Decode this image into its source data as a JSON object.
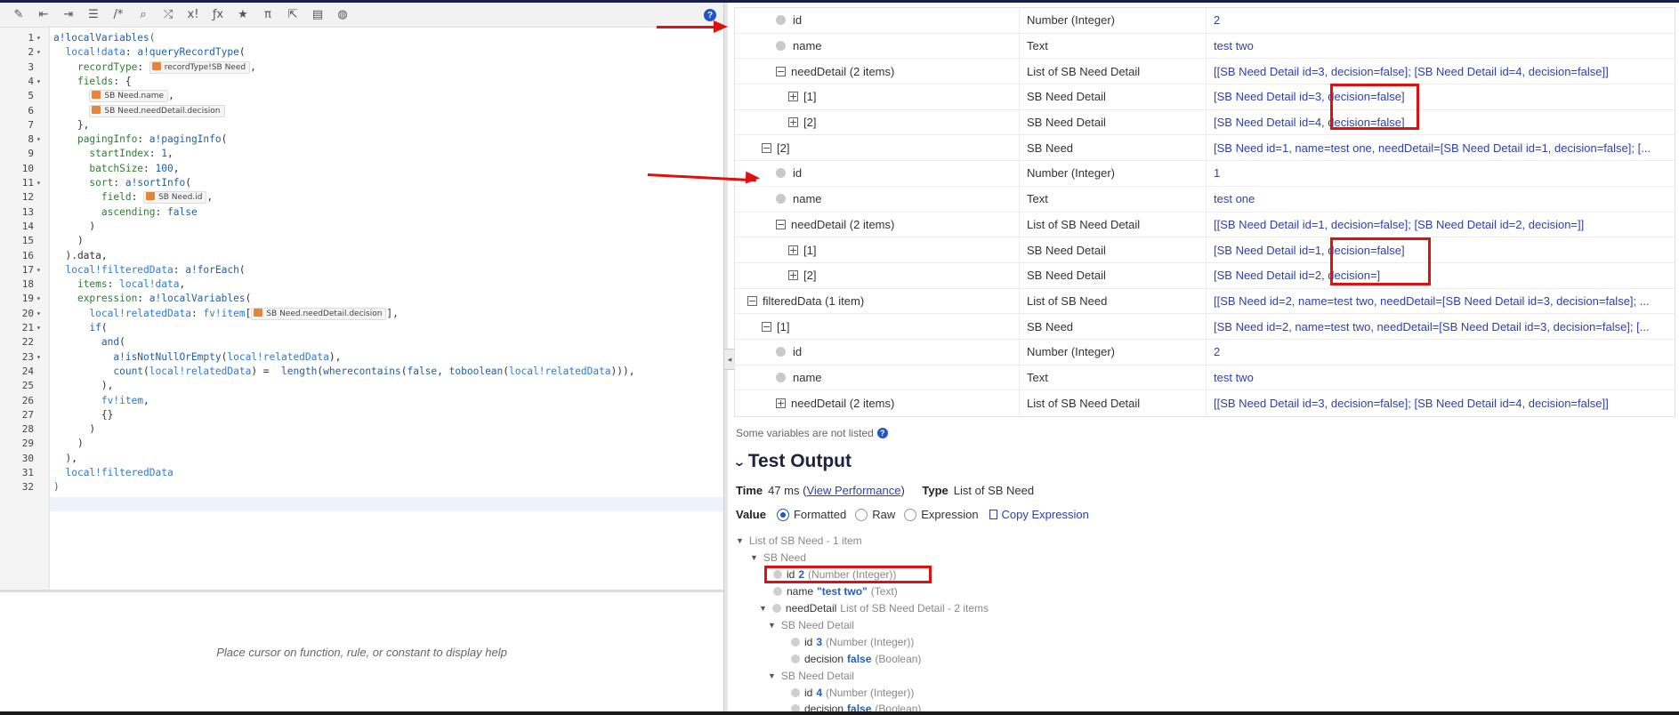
{
  "toolbar": {
    "items": [
      "wand-icon",
      "outdent-icon",
      "indent-icon",
      "list-icon",
      "comment-icon",
      "search-icon",
      "shuffle-icon",
      "exclamation-icon",
      "function-icon",
      "star-icon",
      "pi-icon",
      "export-icon",
      "database-icon",
      "globe-icon"
    ],
    "labels": [
      "✎",
      "⇤",
      "⇥",
      "☰",
      "/*",
      "⌕",
      "⤮",
      "x!",
      "ƒx",
      "★",
      "π",
      "⇱",
      "▤",
      "◍"
    ],
    "help": "?"
  },
  "editor": {
    "line_numbers": [
      "1",
      "2",
      "3",
      "4",
      "5",
      "6",
      "7",
      "8",
      "9",
      "10",
      "11",
      "12",
      "13",
      "14",
      "15",
      "16",
      "17",
      "18",
      "19",
      "20",
      "21",
      "22",
      "23",
      "24",
      "25",
      "26",
      "27",
      "28",
      "29",
      "30",
      "31",
      "32"
    ],
    "tokens": {
      "recordtype_sb": "recordType!SB Need",
      "sb_name": "SB Need.name",
      "sb_decision": "SB Need.needDetail.decision",
      "sb_id": "SB Need.id",
      "sb_decision2": "SB Need.needDetail.decision"
    },
    "help_text": "Place cursor on function, rule, or constant to display help"
  },
  "table": {
    "rows": [
      {
        "indent": 1,
        "kind": "dot",
        "name": "id",
        "type": "Number (Integer)",
        "value": "2"
      },
      {
        "indent": 1,
        "kind": "dot",
        "name": "name",
        "type": "Text",
        "value": "test two"
      },
      {
        "indent": 1,
        "kind": "minus",
        "name": "needDetail (2 items)",
        "type": "List of SB Need Detail",
        "value": "[[SB Need Detail id=3, decision=false]; [SB Need Detail id=4, decision=false]]"
      },
      {
        "indent": 2,
        "kind": "plus",
        "name": "[1]",
        "type": "SB Need Detail",
        "value": "[SB Need Detail id=3, decision=false]"
      },
      {
        "indent": 2,
        "kind": "plus",
        "name": "[2]",
        "type": "SB Need Detail",
        "value": "[SB Need Detail id=4, decision=false]"
      },
      {
        "indent": 0,
        "kind": "minus",
        "name": "[2]",
        "type": "SB Need",
        "value": "[SB Need id=1, name=test one, needDetail=[SB Need Detail id=1, decision=false]; [..."
      },
      {
        "indent": 1,
        "kind": "dot",
        "name": "id",
        "type": "Number (Integer)",
        "value": "1"
      },
      {
        "indent": 1,
        "kind": "dot",
        "name": "name",
        "type": "Text",
        "value": "test one"
      },
      {
        "indent": 1,
        "kind": "minus",
        "name": "needDetail (2 items)",
        "type": "List of SB Need Detail",
        "value": "[[SB Need Detail id=1, decision=false]; [SB Need Detail id=2, decision=]]"
      },
      {
        "indent": 2,
        "kind": "plus",
        "name": "[1]",
        "type": "SB Need Detail",
        "value": "[SB Need Detail id=1, decision=false]"
      },
      {
        "indent": 2,
        "kind": "plus",
        "name": "[2]",
        "type": "SB Need Detail",
        "value": "[SB Need Detail id=2, decision=]"
      },
      {
        "indent": -1,
        "kind": "minus",
        "name": "filteredData (1 item)",
        "type": "List of SB Need",
        "value": "[[SB Need id=2, name=test two, needDetail=[SB Need Detail id=3, decision=false]; ..."
      },
      {
        "indent": 0,
        "kind": "minus",
        "name": "[1]",
        "type": "SB Need",
        "value": "[SB Need id=2, name=test two, needDetail=[SB Need Detail id=3, decision=false]; [..."
      },
      {
        "indent": 1,
        "kind": "dot",
        "name": "id",
        "type": "Number (Integer)",
        "value": "2"
      },
      {
        "indent": 1,
        "kind": "dot",
        "name": "name",
        "type": "Text",
        "value": "test two"
      },
      {
        "indent": 1,
        "kind": "plus",
        "name": "needDetail (2 items)",
        "type": "List of SB Need Detail",
        "value": "[[SB Need Detail id=3, decision=false]; [SB Need Detail id=4, decision=false]]"
      }
    ]
  },
  "not_listed": "Some variables are not listed",
  "test_output": {
    "title": "Test Output",
    "time_label": "Time",
    "time_value": "47 ms (",
    "view_perf": "View Performance",
    "time_close": ")",
    "type_label": "Type",
    "type_value": "List of SB Need",
    "value_label": "Value",
    "options": [
      "Formatted",
      "Raw",
      "Expression"
    ],
    "selected": "Formatted",
    "copy": "Copy Expression"
  },
  "tree": {
    "root": "List of SB Need - 1 item",
    "sbneed": "SB Need",
    "id_k": "id",
    "id_v": "2",
    "id_t": "(Number (Integer))",
    "name_k": "name",
    "name_v": "\"test two\"",
    "name_t": "(Text)",
    "nd_k": "needDetail",
    "nd_t": "List of SB Need Detail - 2 items",
    "sbnd": "SB Need Detail",
    "d1_id_k": "id",
    "d1_id_v": "3",
    "d1_id_t": "(Number (Integer))",
    "d1_dec_k": "decision",
    "d1_dec_v": "false",
    "d1_dec_t": "(Boolean)",
    "sbnd2": "SB Need Detail",
    "d2_id_k": "id",
    "d2_id_v": "4",
    "d2_id_t": "(Number (Integer))",
    "d2_dec_k": "decision",
    "d2_dec_v": "false",
    "d2_dec_t": "(Boolean)"
  },
  "colors": {
    "accent": "#1f55c8",
    "annotation": "#e01010",
    "link": "#2d3fb0"
  }
}
